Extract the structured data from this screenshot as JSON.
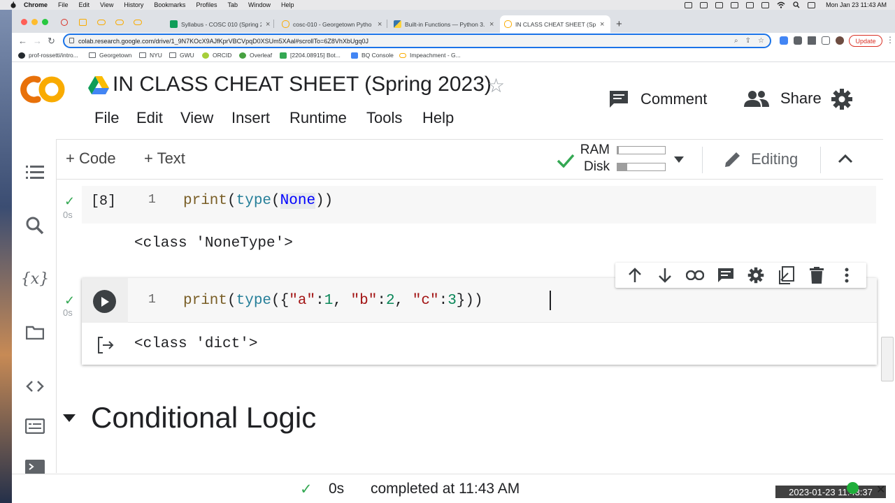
{
  "menubar": {
    "app": "Chrome",
    "items": [
      "File",
      "Edit",
      "View",
      "History",
      "Bookmarks",
      "Profiles",
      "Tab",
      "Window",
      "Help"
    ],
    "clock": "Mon Jan 23  11:43 AM"
  },
  "tabs": [
    {
      "label": "Syllabus - COSC 010 (Spring 2",
      "icon": "sheets-icon",
      "color": "#0f9d58"
    },
    {
      "label": "cosc-010 - Georgetown Pytho",
      "icon": "colab-icon",
      "color": "#f9ab00"
    },
    {
      "label": "Built-in Functions — Python 3.",
      "icon": "python-icon",
      "color": "#3776ab"
    },
    {
      "label": "IN CLASS CHEAT SHEET (Sprin",
      "icon": "colab-icon",
      "color": "#f9ab00"
    }
  ],
  "address_bar": {
    "url": "colab.research.google.com/drive/1_9N7KOcX9AJfKprVBCVpqD0XSUm5XAal#scrollTo=6Z8VhXbUgq0J"
  },
  "update_button": "Update",
  "bookmarks": [
    {
      "label": "prof-rossetti/intro...",
      "icon": "github-icon"
    },
    {
      "label": "Georgetown",
      "icon": "folder-icon"
    },
    {
      "label": "NYU",
      "icon": "folder-icon"
    },
    {
      "label": "GWU",
      "icon": "folder-icon"
    },
    {
      "label": "ORCID",
      "icon": "orcid-icon"
    },
    {
      "label": "Overleaf",
      "icon": "overleaf-icon"
    },
    {
      "label": "[2204.08915] Bot...",
      "icon": "arxiv-icon"
    },
    {
      "label": "BQ Console",
      "icon": "bigquery-icon"
    },
    {
      "label": "Impeachment - G...",
      "icon": "colab-icon"
    }
  ],
  "colab": {
    "title": "IN CLASS CHEAT SHEET (Spring 2023)",
    "menu": [
      "File",
      "Edit",
      "View",
      "Insert",
      "Runtime",
      "Tools",
      "Help"
    ],
    "comment": "Comment",
    "share": "Share",
    "add_code": "+ Code",
    "add_text": "+ Text",
    "ram_label": "RAM",
    "disk_label": "Disk",
    "ram_usage": 0.03,
    "disk_usage": 0.2,
    "editing": "Editing"
  },
  "cells": [
    {
      "exec_count": "[8]",
      "line_number": "1",
      "time": "0s",
      "code": {
        "fn1": "print",
        "p1": "(",
        "fn2": "type",
        "p2": "(",
        "arg": "None",
        "p3": "))"
      },
      "output": "<class 'NoneType'>"
    },
    {
      "line_number": "1",
      "time": "0s",
      "code": {
        "fn1": "print",
        "p1": "(",
        "fn2": "type",
        "p2": "({",
        "s1": "\"a\"",
        "c1": ":",
        "n1": "1",
        "sep1": ", ",
        "s2": "\"b\"",
        "c2": ":",
        "n2": "2",
        "sep2": ", ",
        "s3": "\"c\"",
        "c3": ":",
        "n3": "3",
        "p3": "}))"
      },
      "output": "<class 'dict'>"
    }
  ],
  "section_title": "Conditional Logic",
  "status": {
    "time": "0s",
    "completed": "completed at 11:43 AM"
  },
  "recording_timestamp": "2023-01-23  11:43:37"
}
